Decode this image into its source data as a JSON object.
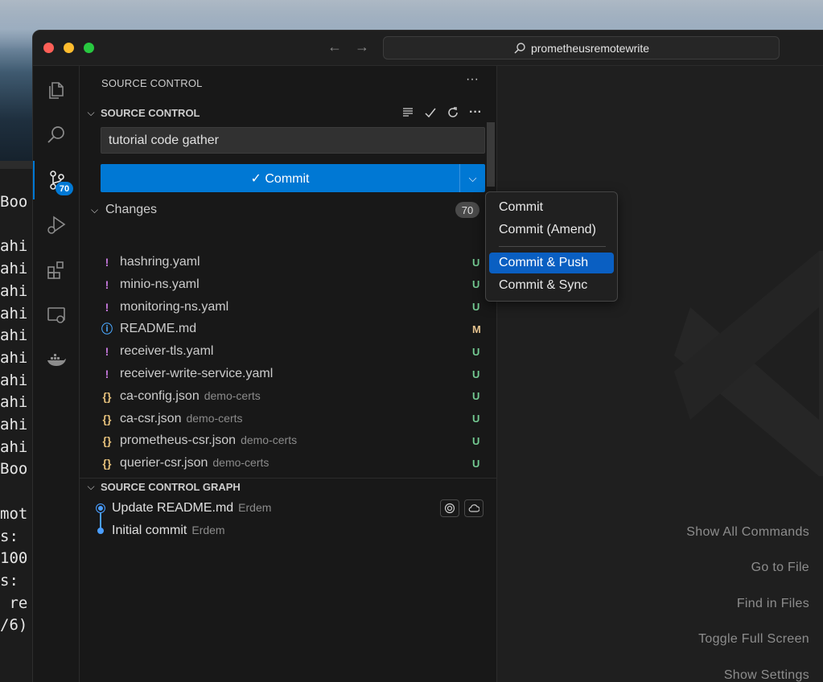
{
  "window": {
    "search_text": "prometheusremotewrite"
  },
  "terminal": {
    "lines": [
      "Boo",
      "",
      "ahi",
      "ahi",
      "ahi",
      "ahi",
      "ahi",
      "ahi",
      "ahi",
      "ahi",
      "ahi",
      "ahi",
      "Boo",
      "",
      "mot",
      "s:",
      "100",
      "s:",
      " re",
      "/6)"
    ]
  },
  "activity_bar": {
    "scm_badge": "70"
  },
  "sidebar": {
    "header": "SOURCE CONTROL",
    "more": "···",
    "scm_section_title": "SOURCE CONTROL",
    "commit_message": "tutorial code gather",
    "commit_label": "✓ Commit",
    "changes_label": "Changes",
    "changes_count": "70",
    "files": [
      {
        "icon": "!",
        "icon_color": "#c678dd",
        "name": "hashring.yaml",
        "dir": "",
        "status": "U",
        "status_color": "#73c991"
      },
      {
        "icon": "!",
        "icon_color": "#c678dd",
        "name": "minio-ns.yaml",
        "dir": "",
        "status": "U",
        "status_color": "#73c991"
      },
      {
        "icon": "!",
        "icon_color": "#c678dd",
        "name": "monitoring-ns.yaml",
        "dir": "",
        "status": "U",
        "status_color": "#73c991"
      },
      {
        "icon": "ⓘ",
        "icon_color": "#4aa8ff",
        "name": "README.md",
        "dir": "",
        "status": "M",
        "status_color": "#e2c08d"
      },
      {
        "icon": "!",
        "icon_color": "#c678dd",
        "name": "receiver-tls.yaml",
        "dir": "",
        "status": "U",
        "status_color": "#73c991"
      },
      {
        "icon": "!",
        "icon_color": "#c678dd",
        "name": "receiver-write-service.yaml",
        "dir": "",
        "status": "U",
        "status_color": "#73c991"
      },
      {
        "icon": "{}",
        "icon_color": "#e5c07b",
        "name": "ca-config.json",
        "dir": "demo-certs",
        "status": "U",
        "status_color": "#73c991"
      },
      {
        "icon": "{}",
        "icon_color": "#e5c07b",
        "name": "ca-csr.json",
        "dir": "demo-certs",
        "status": "U",
        "status_color": "#73c991"
      },
      {
        "icon": "{}",
        "icon_color": "#e5c07b",
        "name": "prometheus-csr.json",
        "dir": "demo-certs",
        "status": "U",
        "status_color": "#73c991"
      },
      {
        "icon": "{}",
        "icon_color": "#e5c07b",
        "name": "querier-csr.json",
        "dir": "demo-certs",
        "status": "U",
        "status_color": "#73c991"
      }
    ],
    "graph_title": "SOURCE CONTROL GRAPH",
    "graph": [
      {
        "message": "Update README.md",
        "author": "Erdem"
      },
      {
        "message": "Initial commit",
        "author": "Erdem"
      }
    ]
  },
  "commit_menu": {
    "items": [
      "Commit",
      "Commit (Amend)",
      "Commit & Push",
      "Commit & Sync"
    ],
    "selected": "Commit & Push"
  },
  "editor": {
    "shortcuts": [
      "Show All Commands",
      "Go to File",
      "Find in Files",
      "Toggle Full Screen",
      "Show Settings"
    ]
  },
  "colors": {
    "accent": "#0078d4",
    "menu_selected": "#0a5fc2"
  }
}
